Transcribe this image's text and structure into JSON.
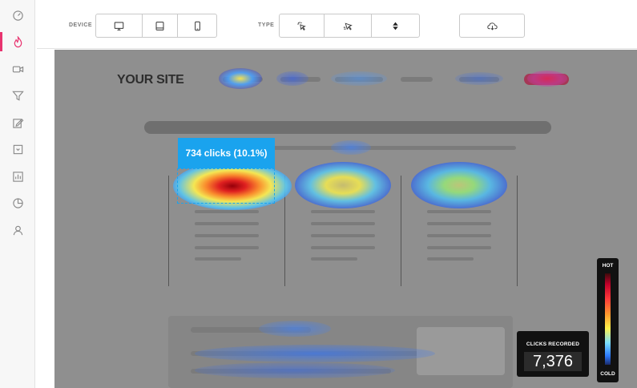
{
  "toolbar": {
    "device_label": "DEVICE",
    "type_label": "TYPE",
    "device_buttons": [
      "desktop-icon",
      "tablet-icon",
      "phone-icon"
    ],
    "type_buttons": [
      "click-icon",
      "move-icon",
      "scroll-icon"
    ],
    "download_button": "cloud-download-icon"
  },
  "sidebar": {
    "items": [
      "dashboard-icon",
      "heatmap-icon",
      "recordings-icon",
      "funnel-icon",
      "forms-icon",
      "feedback-icon",
      "polls-icon",
      "analytics-icon",
      "users-icon"
    ],
    "active": "heatmap-icon"
  },
  "page": {
    "logo_text": "YOUR SITE"
  },
  "tooltip": {
    "text": "734 clicks (10.1%)"
  },
  "stats": {
    "clicks_label": "CLICKS RECORDED",
    "clicks_value": "7,376"
  },
  "legend": {
    "hot_label": "HOT",
    "cold_label": "COLD"
  },
  "colors": {
    "accent": "#e8336f",
    "tooltip": "#1aa3ee",
    "overlay": "#8f8f8f"
  }
}
